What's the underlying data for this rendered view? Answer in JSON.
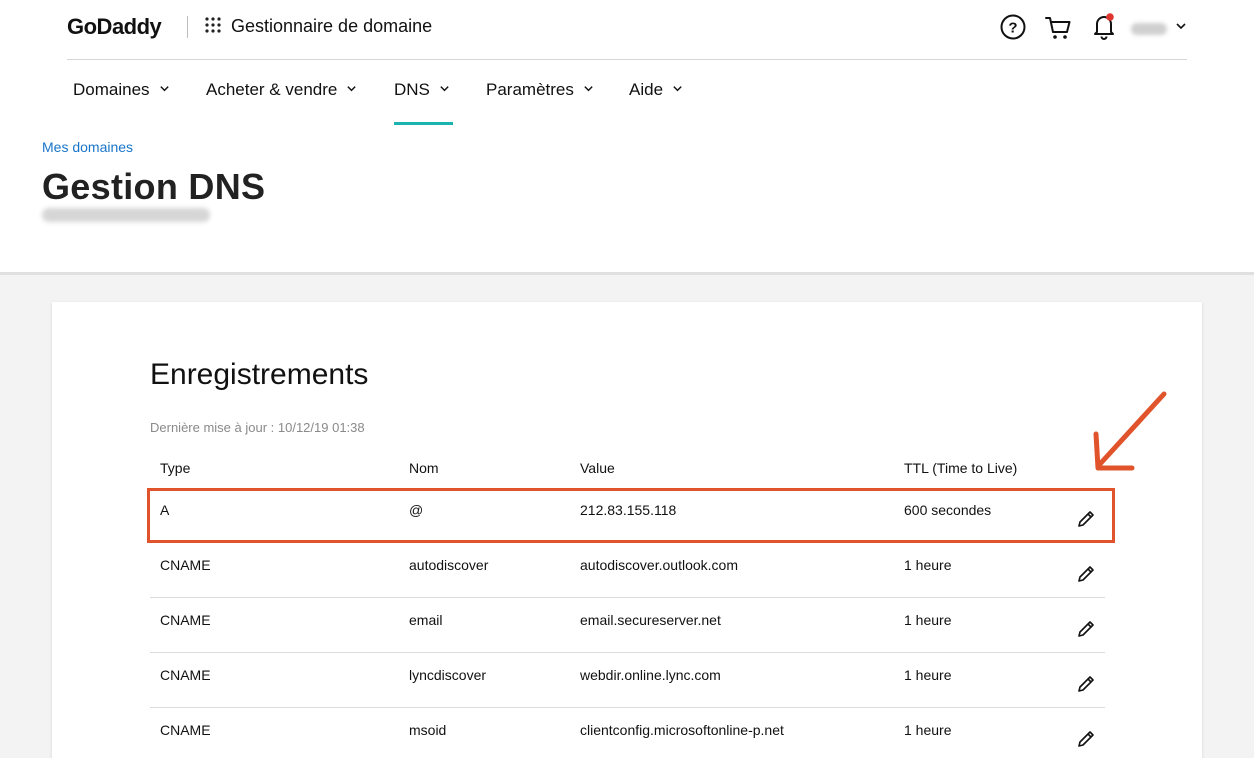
{
  "header": {
    "logo": "GoDaddy",
    "app_title": "Gestionnaire de domaine",
    "icons": [
      "apps-grid-icon",
      "help-icon",
      "cart-icon",
      "bell-icon",
      "chevron-down-icon"
    ]
  },
  "nav": {
    "items": [
      {
        "label": "Domaines",
        "active": false
      },
      {
        "label": "Acheter & vendre",
        "active": false
      },
      {
        "label": "DNS",
        "active": true
      },
      {
        "label": "Paramètres",
        "active": false
      },
      {
        "label": "Aide",
        "active": false
      }
    ]
  },
  "breadcrumb": "Mes domaines",
  "page_title": "Gestion DNS",
  "records": {
    "title": "Enregistrements",
    "last_update": "Dernière mise à jour : 10/12/19 01:38",
    "columns": [
      "Type",
      "Nom",
      "Value",
      "TTL (Time to Live)"
    ],
    "rows": [
      {
        "type": "A",
        "name": "@",
        "value": "212.83.155.118",
        "ttl": "600 secondes"
      },
      {
        "type": "CNAME",
        "name": "autodiscover",
        "value": "autodiscover.outlook.com",
        "ttl": "1 heure"
      },
      {
        "type": "CNAME",
        "name": "email",
        "value": "email.secureserver.net",
        "ttl": "1 heure"
      },
      {
        "type": "CNAME",
        "name": "lyncdiscover",
        "value": "webdir.online.lync.com",
        "ttl": "1 heure"
      },
      {
        "type": "CNAME",
        "name": "msoid",
        "value": "clientconfig.microsoftonline-p.net",
        "ttl": "1 heure"
      }
    ]
  },
  "colors": {
    "active_tab": "#1bb3b0",
    "link": "#1875c9",
    "annotation": "#e0532b",
    "notification_dot": "#e0342f"
  }
}
